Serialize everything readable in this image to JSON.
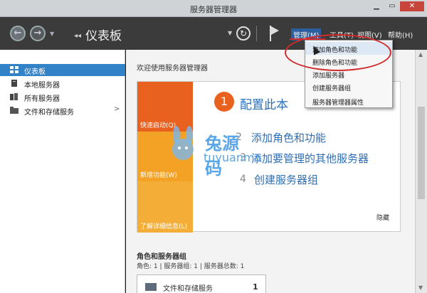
{
  "window": {
    "title": "服务器管理器",
    "min": "▁",
    "max": "▭",
    "close": "✕"
  },
  "nav": {
    "breadcrumb": "仪表板",
    "menus": [
      "管理(M)",
      "工具(T)",
      "视图(V)",
      "帮助(H)"
    ]
  },
  "sidebar": {
    "items": [
      {
        "label": "仪表板",
        "icon": "dashboard-icon",
        "selected": true
      },
      {
        "label": "本地服务器",
        "icon": "server-icon"
      },
      {
        "label": "所有服务器",
        "icon": "servers-icon"
      },
      {
        "label": "文件和存储服务",
        "icon": "file-storage-icon",
        "arrow": ">"
      }
    ]
  },
  "main": {
    "welcome": "欢迎使用服务器管理器",
    "tiles": [
      "快速启动(Q)",
      "新增功能(W)",
      "了解详细信息(L)"
    ],
    "steps": [
      {
        "num": "1",
        "text": "配置此本"
      },
      {
        "num": "2",
        "text": "添加角色和功能"
      },
      {
        "num": "3",
        "text": "添加要管理的其他服务器"
      },
      {
        "num": "4",
        "text": "创建服务器组"
      }
    ],
    "hide": "隐藏",
    "roles_title": "角色和服务器组",
    "roles_sub": "角色: 1 | 服务器组: 1 | 服务器总数: 1",
    "card": {
      "text": "文件和存储服务",
      "count": "1"
    }
  },
  "dropdown": {
    "items": [
      "添加角色和功能",
      "删除角色和功能",
      "添加服务器",
      "创建服务器组",
      "服务器管理器属性"
    ]
  },
  "watermark": {
    "line1": "兔源码",
    "line2": "tuyuanma"
  },
  "colors": {
    "accent": "#3282c8",
    "orange": "#e8611f",
    "highlight": "#d12b2b"
  }
}
